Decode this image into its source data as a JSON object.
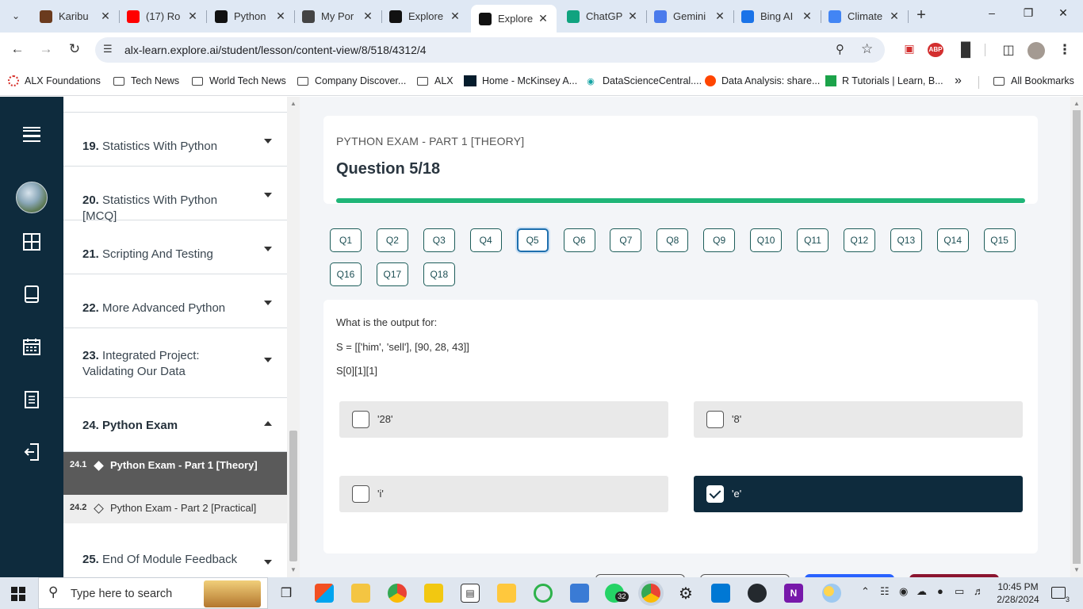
{
  "browser": {
    "tabs": [
      {
        "title": "Karibu",
        "favicon": "karibu-icon",
        "color": "#6b3b1e"
      },
      {
        "title": "(17) Ro",
        "favicon": "youtube-icon",
        "color": "#ff0000"
      },
      {
        "title": "Python",
        "favicon": "github-icon",
        "color": "#111111"
      },
      {
        "title": "My Por",
        "favicon": "portfolio-icon",
        "color": "#444444"
      },
      {
        "title": "Explore",
        "favicon": "explore-icon",
        "color": "#111111"
      },
      {
        "title": "Explore",
        "favicon": "explore-icon",
        "color": "#111111",
        "active": true
      },
      {
        "title": "ChatGP",
        "favicon": "chatgpt-icon",
        "color": "#10a37f"
      },
      {
        "title": "Gemini",
        "favicon": "gemini-icon",
        "color": "#4b7bec"
      },
      {
        "title": "Bing AI",
        "favicon": "bing-icon",
        "color": "#1a73e8"
      },
      {
        "title": "Climate",
        "favicon": "google-icon",
        "color": "#4285f4"
      }
    ],
    "url": "alx-learn.explore.ai/student/lesson/content-view/8/518/4312/4",
    "bookmarks": [
      {
        "label": "ALX Foundations",
        "icon": "alx-icon"
      },
      {
        "label": "Tech News",
        "icon": "folder-icon"
      },
      {
        "label": "World Tech News",
        "icon": "folder-icon"
      },
      {
        "label": "Company Discover...",
        "icon": "folder-icon"
      },
      {
        "label": "ALX",
        "icon": "folder-icon"
      },
      {
        "label": "Home - McKinsey A...",
        "icon": "mckinsey-icon"
      },
      {
        "label": "DataScienceCentral....",
        "icon": "dsc-icon"
      },
      {
        "label": "Data Analysis: share...",
        "icon": "reddit-icon"
      },
      {
        "label": "R Tutorials | Learn, B...",
        "icon": "r-icon"
      }
    ],
    "bookmarks_more": "»",
    "all_bookmarks": "All Bookmarks",
    "ext_abp": "ABP"
  },
  "modules": [
    {
      "num": "19.",
      "title": "Statistics With Python"
    },
    {
      "num": "20.",
      "title": "Statistics With Python [MCQ]"
    },
    {
      "num": "21.",
      "title": "Scripting And Testing"
    },
    {
      "num": "22.",
      "title": "More Advanced Python"
    },
    {
      "num": "23.",
      "title": "Integrated Project: Validating Our Data"
    },
    {
      "num": "24.",
      "title": "Python Exam",
      "expanded": true
    },
    {
      "num": "25.",
      "title": "End Of Module Feedback"
    }
  ],
  "lessons": [
    {
      "num": "24.1",
      "title": "Python Exam - Part 1 [Theory]",
      "active": true
    },
    {
      "num": "24.2",
      "title": "Python Exam - Part 2 [Practical]"
    }
  ],
  "exam": {
    "subtitle": "PYTHON EXAM - PART 1 [THEORY]",
    "title": "Question 5/18",
    "progress": 1.0,
    "progress_color": "#1fb578",
    "questions": [
      "Q1",
      "Q2",
      "Q3",
      "Q4",
      "Q5",
      "Q6",
      "Q7",
      "Q8",
      "Q9",
      "Q10",
      "Q11",
      "Q12",
      "Q13",
      "Q14",
      "Q15",
      "Q16",
      "Q17",
      "Q18"
    ],
    "current": "Q5",
    "prompt_lines": [
      "What is the output for:",
      "S = [['him', 'sell'], [90, 28, 43]]",
      "S[0][1][1]"
    ],
    "options": [
      {
        "label": "'28'",
        "selected": false
      },
      {
        "label": "'8'",
        "selected": false
      },
      {
        "label": "'i'",
        "selected": false
      },
      {
        "label": "'e'",
        "selected": true
      }
    ]
  },
  "taskbar": {
    "search_placeholder": "Type here to search",
    "whatsapp_badge": "32",
    "time": "10:45 PM",
    "date": "2/28/2024",
    "notifications": "3"
  },
  "colors": {
    "sidebar": "#0e2b3d",
    "selected_option": "#0e2b3d",
    "accent": "#1fb578"
  }
}
